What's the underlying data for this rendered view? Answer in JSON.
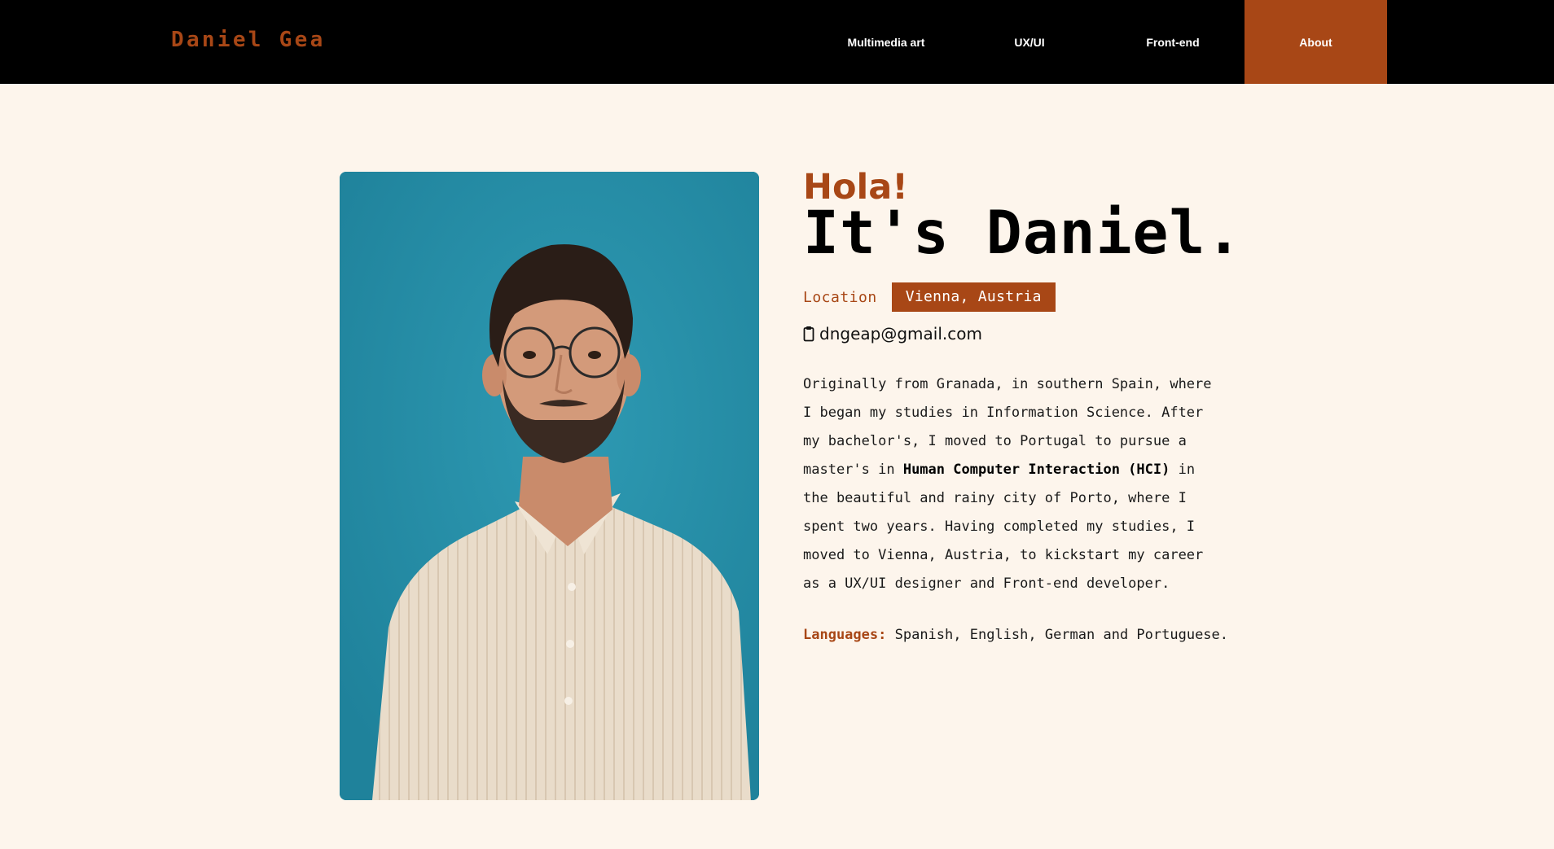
{
  "nav": {
    "brand": "Daniel Gea",
    "links": [
      {
        "label": "Multimedia art",
        "active": false
      },
      {
        "label": "UX/UI",
        "active": false
      },
      {
        "label": "Front-end",
        "active": false
      },
      {
        "label": "About",
        "active": true
      }
    ]
  },
  "colors": {
    "accent": "#a84716",
    "navbar": "#000000",
    "background": "#fdf5ec",
    "photo_backdrop": "#268ea7"
  },
  "about": {
    "greeting": "Hola!",
    "headline": "It's Daniel.",
    "location_label": "Location",
    "location_value": "Vienna, Austria",
    "email_icon": "clipboard-icon",
    "email": "dngeap@gmail.com",
    "bio_before": "Originally from Granada, in southern Spain, where I began my studies in Information Science. After my bachelor's, I moved to Portugal to pursue a master's in ",
    "bio_bold": "Human Computer Interaction (HCI)",
    "bio_after": " in the beautiful and rainy city of Porto, where I spent two years. Having completed my studies, I moved to Vienna, Austria, to kickstart my career as a UX/UI designer and Front-end developer.",
    "languages_label": "Languages:",
    "languages_value": "Spanish, English, German and Portuguese."
  }
}
